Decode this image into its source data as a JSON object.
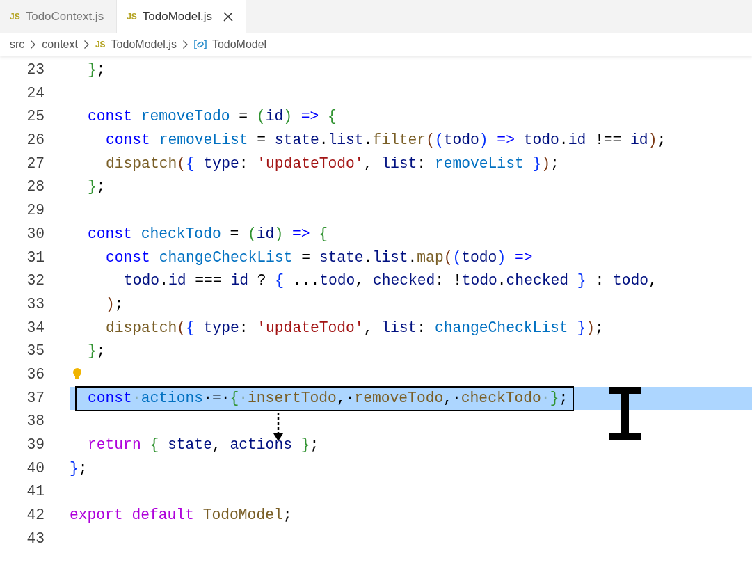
{
  "tabs": [
    {
      "icon": "JS",
      "label": "TodoContext.js",
      "selected": false
    },
    {
      "icon": "JS",
      "label": "TodoModel.js",
      "selected": true
    }
  ],
  "breadcrumb": [
    {
      "kind": "folder",
      "label": "src"
    },
    {
      "kind": "folder",
      "label": "context"
    },
    {
      "kind": "file",
      "icon": "JS",
      "label": "TodoModel.js"
    },
    {
      "kind": "symbol",
      "label": "TodoModel"
    }
  ],
  "lines": [
    {
      "children": [
        {
          "n": "23",
          "tokens": [
            {
              "text": "}",
              "kind": "b2"
            },
            {
              "text": ";",
              "kind": "p"
            }
          ]
        },
        {
          "n": "24"
        },
        {
          "n": "25",
          "tokens": [
            {
              "text": "const ",
              "kind": "kw"
            },
            {
              "text": "removeTodo",
              "kind": "decl"
            },
            {
              "text": " = ",
              "kind": "p"
            },
            {
              "text": "(",
              "kind": "b2"
            },
            {
              "text": "id",
              "kind": "var"
            },
            {
              "text": ")",
              "kind": "b2"
            },
            {
              "text": " => ",
              "kind": "kw"
            },
            {
              "text": "{",
              "kind": "b2"
            }
          ],
          "children": [
            {
              "n": "26",
              "tokens": [
                {
                  "text": "const ",
                  "kind": "kw"
                },
                {
                  "text": "removeList",
                  "kind": "decl"
                },
                {
                  "text": " = ",
                  "kind": "p"
                },
                {
                  "text": "state",
                  "kind": "var"
                },
                {
                  "text": ".",
                  "kind": "p"
                },
                {
                  "text": "list",
                  "kind": "var"
                },
                {
                  "text": ".",
                  "kind": "p"
                },
                {
                  "text": "filter",
                  "kind": "fn"
                },
                {
                  "text": "(",
                  "kind": "b3"
                },
                {
                  "text": "(",
                  "kind": "b1"
                },
                {
                  "text": "todo",
                  "kind": "var"
                },
                {
                  "text": ")",
                  "kind": "b1"
                },
                {
                  "text": " => ",
                  "kind": "kw"
                },
                {
                  "text": "todo",
                  "kind": "var"
                },
                {
                  "text": ".",
                  "kind": "p"
                },
                {
                  "text": "id",
                  "kind": "var"
                },
                {
                  "text": " !== ",
                  "kind": "p"
                },
                {
                  "text": "id",
                  "kind": "var"
                },
                {
                  "text": ")",
                  "kind": "b3"
                },
                {
                  "text": ";",
                  "kind": "p"
                }
              ]
            },
            {
              "n": "27",
              "tokens": [
                {
                  "text": "dispatch",
                  "kind": "fn"
                },
                {
                  "text": "(",
                  "kind": "b3"
                },
                {
                  "text": "{ ",
                  "kind": "b1"
                },
                {
                  "text": "type",
                  "kind": "var"
                },
                {
                  "text": ": ",
                  "kind": "p"
                },
                {
                  "text": "'updateTodo'",
                  "kind": "str"
                },
                {
                  "text": ", ",
                  "kind": "p"
                },
                {
                  "text": "list",
                  "kind": "var"
                },
                {
                  "text": ": ",
                  "kind": "p"
                },
                {
                  "text": "removeList",
                  "kind": "decl"
                },
                {
                  "text": " }",
                  "kind": "b1"
                },
                {
                  "text": ")",
                  "kind": "b3"
                },
                {
                  "text": ";",
                  "kind": "p"
                }
              ]
            }
          ]
        },
        {
          "n": "28",
          "tokens": [
            {
              "text": "}",
              "kind": "b2"
            },
            {
              "text": ";",
              "kind": "p"
            }
          ]
        },
        {
          "n": "29"
        },
        {
          "n": "30",
          "tokens": [
            {
              "text": "const ",
              "kind": "kw"
            },
            {
              "text": "checkTodo",
              "kind": "decl"
            },
            {
              "text": " = ",
              "kind": "p"
            },
            {
              "text": "(",
              "kind": "b2"
            },
            {
              "text": "id",
              "kind": "var"
            },
            {
              "text": ")",
              "kind": "b2"
            },
            {
              "text": " => ",
              "kind": "kw"
            },
            {
              "text": "{",
              "kind": "b2"
            }
          ],
          "children": [
            {
              "n": "31",
              "tokens": [
                {
                  "text": "const ",
                  "kind": "kw"
                },
                {
                  "text": "changeCheckList",
                  "kind": "decl"
                },
                {
                  "text": " = ",
                  "kind": "p"
                },
                {
                  "text": "state",
                  "kind": "var"
                },
                {
                  "text": ".",
                  "kind": "p"
                },
                {
                  "text": "list",
                  "kind": "var"
                },
                {
                  "text": ".",
                  "kind": "p"
                },
                {
                  "text": "map",
                  "kind": "fn"
                },
                {
                  "text": "(",
                  "kind": "b3"
                },
                {
                  "text": "(",
                  "kind": "b1"
                },
                {
                  "text": "todo",
                  "kind": "var"
                },
                {
                  "text": ")",
                  "kind": "b1"
                },
                {
                  "text": " =>",
                  "kind": "kw"
                }
              ],
              "children": [
                {
                  "n": "32",
                  "tokens": [
                    {
                      "text": "todo",
                      "kind": "var"
                    },
                    {
                      "text": ".",
                      "kind": "p"
                    },
                    {
                      "text": "id",
                      "kind": "var"
                    },
                    {
                      "text": " === ",
                      "kind": "p"
                    },
                    {
                      "text": "id",
                      "kind": "var"
                    },
                    {
                      "text": " ? ",
                      "kind": "p"
                    },
                    {
                      "text": "{ ",
                      "kind": "b1"
                    },
                    {
                      "text": "...",
                      "kind": "p"
                    },
                    {
                      "text": "todo",
                      "kind": "var"
                    },
                    {
                      "text": ", ",
                      "kind": "p"
                    },
                    {
                      "text": "checked",
                      "kind": "var"
                    },
                    {
                      "text": ": !",
                      "kind": "p"
                    },
                    {
                      "text": "todo",
                      "kind": "var"
                    },
                    {
                      "text": ".",
                      "kind": "p"
                    },
                    {
                      "text": "checked",
                      "kind": "var"
                    },
                    {
                      "text": " }",
                      "kind": "b1"
                    },
                    {
                      "text": " : ",
                      "kind": "p"
                    },
                    {
                      "text": "todo",
                      "kind": "var"
                    },
                    {
                      "text": ",",
                      "kind": "p"
                    }
                  ]
                }
              ]
            },
            {
              "n": "33",
              "tokens": [
                {
                  "text": ")",
                  "kind": "b3"
                },
                {
                  "text": ";",
                  "kind": "p"
                }
              ]
            },
            {
              "n": "34",
              "tokens": [
                {
                  "text": "dispatch",
                  "kind": "fn"
                },
                {
                  "text": "(",
                  "kind": "b3"
                },
                {
                  "text": "{ ",
                  "kind": "b1"
                },
                {
                  "text": "type",
                  "kind": "var"
                },
                {
                  "text": ": ",
                  "kind": "p"
                },
                {
                  "text": "'updateTodo'",
                  "kind": "str"
                },
                {
                  "text": ", ",
                  "kind": "p"
                },
                {
                  "text": "list",
                  "kind": "var"
                },
                {
                  "text": ": ",
                  "kind": "p"
                },
                {
                  "text": "changeCheckList",
                  "kind": "decl"
                },
                {
                  "text": " }",
                  "kind": "b1"
                },
                {
                  "text": ")",
                  "kind": "b3"
                },
                {
                  "text": ";",
                  "kind": "p"
                }
              ]
            }
          ]
        },
        {
          "n": "35",
          "tokens": [
            {
              "text": "}",
              "kind": "b2"
            },
            {
              "text": ";",
              "kind": "p"
            }
          ]
        },
        {
          "n": "36",
          "lightbulb": true
        },
        {
          "n": "37",
          "selected": true,
          "tokens": [
            {
              "text": "const",
              "kind": "kw"
            },
            {
              "text": "·",
              "kind": "ws"
            },
            {
              "text": "actions",
              "kind": "decl"
            },
            {
              "text": "·=·",
              "kind": "p"
            },
            {
              "text": "{",
              "kind": "b2"
            },
            {
              "text": "·",
              "kind": "ws"
            },
            {
              "text": "insertTodo",
              "kind": "fn"
            },
            {
              "text": ",·",
              "kind": "p"
            },
            {
              "text": "removeTodo",
              "kind": "fn"
            },
            {
              "text": ",·",
              "kind": "p"
            },
            {
              "text": "checkTodo",
              "kind": "fn"
            },
            {
              "text": "·",
              "kind": "ws"
            },
            {
              "text": "}",
              "kind": "b2"
            },
            {
              "text": ";",
              "kind": "p"
            }
          ]
        },
        {
          "n": "38"
        },
        {
          "n": "39",
          "tokens": [
            {
              "text": "return ",
              "kind": "ctl"
            },
            {
              "text": "{ ",
              "kind": "b2"
            },
            {
              "text": "state",
              "kind": "var"
            },
            {
              "text": ", ",
              "kind": "p"
            },
            {
              "text": "actions",
              "kind": "var"
            },
            {
              "text": " }",
              "kind": "b2"
            },
            {
              "text": ";",
              "kind": "p"
            }
          ]
        }
      ]
    },
    {
      "n": "40",
      "tokens": [
        {
          "text": "}",
          "kind": "b1"
        },
        {
          "text": ";",
          "kind": "p"
        }
      ]
    },
    {
      "n": "41"
    },
    {
      "n": "42",
      "tokens": [
        {
          "text": "export ",
          "kind": "ctl"
        },
        {
          "text": "default ",
          "kind": "ctl"
        },
        {
          "text": "TodoModel",
          "kind": "fn"
        },
        {
          "text": ";",
          "kind": "p"
        }
      ]
    },
    {
      "n": "43"
    }
  ]
}
